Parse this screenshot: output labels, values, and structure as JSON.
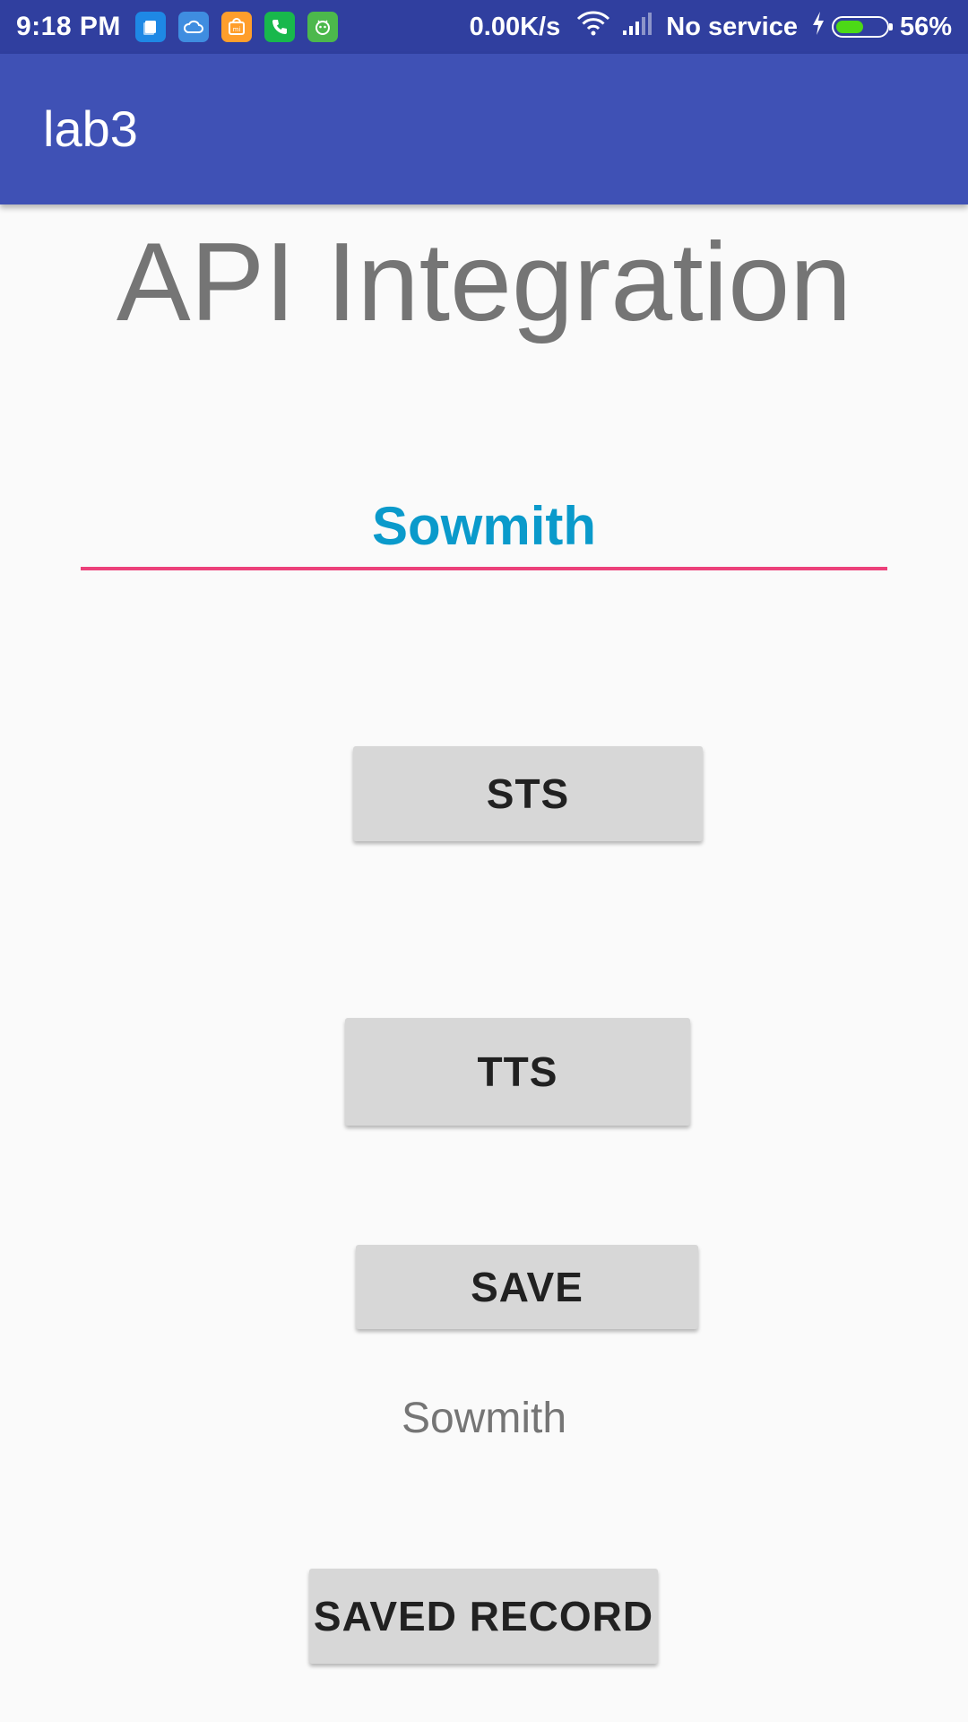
{
  "status_bar": {
    "time": "9:18 PM",
    "net_speed": "0.00K/s",
    "service": "No service",
    "battery_percent": "56%",
    "battery_level": 0.56,
    "notification_icons": [
      {
        "name": "file-manager-icon",
        "color": "#1E88E5"
      },
      {
        "name": "cloud-icon",
        "color": "#3F8DE0"
      },
      {
        "name": "mi-store-icon",
        "color": "#FF9E2C"
      },
      {
        "name": "phone-icon",
        "color": "#18B84C"
      },
      {
        "name": "android-robot-icon",
        "color": "#4CB84C"
      }
    ],
    "icons": [
      "wifi-icon",
      "signal-icon",
      "charging-icon",
      "battery-icon"
    ]
  },
  "app_bar": {
    "title": "lab3"
  },
  "main": {
    "heading": "API Integration",
    "name_input": {
      "value": "Sowmith"
    },
    "buttons": {
      "sts": "STS",
      "tts": "TTS",
      "save": "SAVE",
      "saved_record": "SAVED RECORD"
    },
    "saved_value": "Sowmith"
  },
  "colors": {
    "status_bar": "#303F9F",
    "app_bar": "#3F51B5",
    "accent": "#EC407A",
    "input_text": "#0A9ACB",
    "button_bg": "#D7D7D7",
    "secondary_text": "#757575",
    "background": "#FAFAFA"
  }
}
